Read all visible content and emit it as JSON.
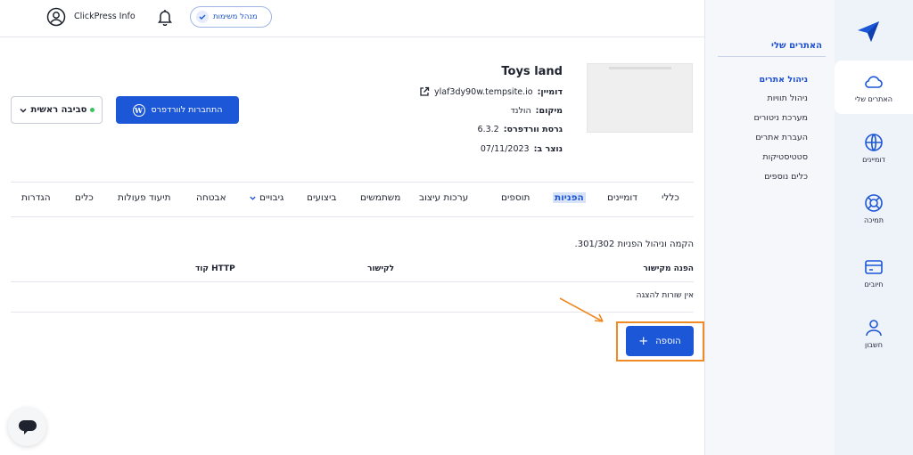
{
  "topbar": {
    "org_name": "ClickPress Info",
    "tasks_button": "מנהל משימות"
  },
  "sidebar_icons": [
    {
      "label": "האתרים שלי",
      "icon": "cloud-icon"
    },
    {
      "label": "דומיינים",
      "icon": "globe-icon"
    },
    {
      "label": "תמיכה",
      "icon": "lifebuoy-icon"
    },
    {
      "label": "חיובים",
      "icon": "credit-card-icon"
    },
    {
      "label": "חשבון",
      "icon": "user-icon"
    }
  ],
  "subnav": {
    "title": "האתרים שלי",
    "items": [
      "ניהול אתרים",
      "ניהול תוויות",
      "מערכת ניטורים",
      "העברת אתרים",
      "סטטיסטיקות",
      "כלים נוספים"
    ]
  },
  "site": {
    "name": "Toys land",
    "domain_label": "דומיין:",
    "domain": "ylaf3dy90w.tempsite.io",
    "location_label": "מיקום:",
    "location": "הולנד",
    "wp_version_label": "גרסת וורדפרס:",
    "wp_version": "6.3.2",
    "created_label": "נוצר ב:",
    "created": "07/11/2023"
  },
  "actions": {
    "wp_login": "התחברות לוורדפרס",
    "environment": "סביבה ראשית"
  },
  "tabs": [
    "כללי",
    "דומיינים",
    "הפניות",
    "תוספים",
    "ערכות עיצוב",
    "משתמשים",
    "ביצועים",
    "גיבויים",
    "אבטחה",
    "תיעוד פעולות",
    "כלים",
    "הגדרות"
  ],
  "active_tab": "הפניות",
  "redirects": {
    "title": "הקמה וניהול הפניות 301/302.",
    "columns": [
      "הפנה מקישור",
      "לקישור",
      "קוד HTTP"
    ],
    "empty_text": "אין שורות להצגה",
    "add_button": "הוספה"
  },
  "colors": {
    "accent": "#1c57d7",
    "highlight": "#f08a24"
  }
}
